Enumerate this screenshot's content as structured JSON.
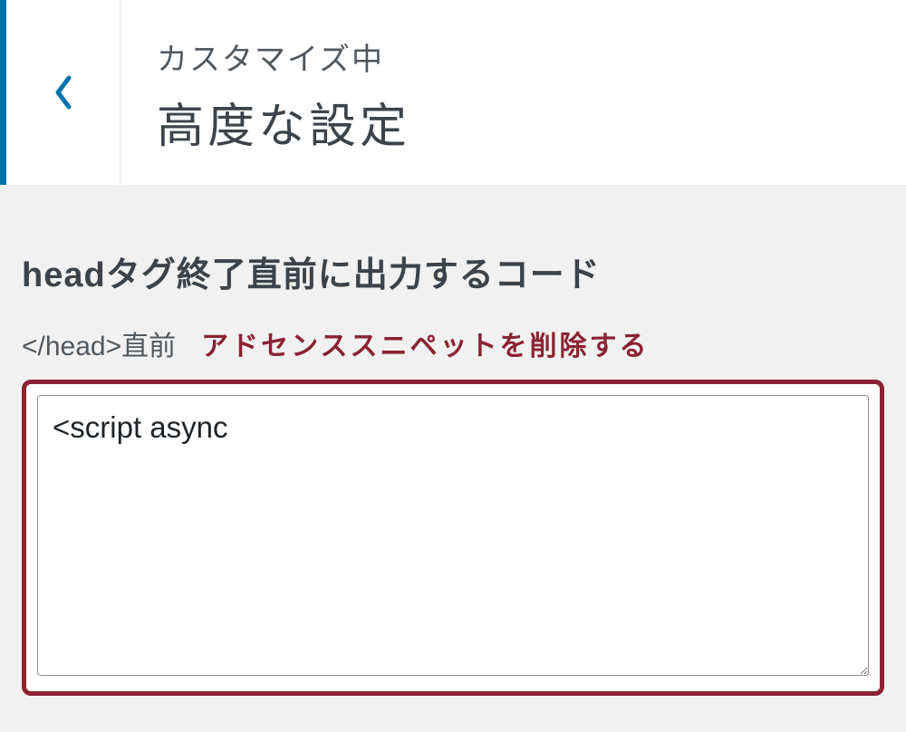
{
  "header": {
    "subtitle": "カスタマイズ中",
    "title": "高度な設定"
  },
  "section": {
    "title": "headタグ終了直前に出力するコード",
    "label": "</head>直前",
    "action": "アドセンススニペットを削除する"
  },
  "textarea": {
    "value": "<script async"
  }
}
